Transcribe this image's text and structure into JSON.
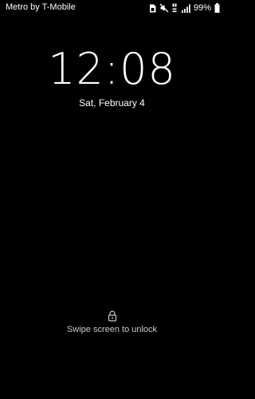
{
  "status_bar": {
    "carrier": "Metro by T-Mobile",
    "battery": "99%",
    "icons": [
      "sim-icon",
      "mute-icon",
      "volte-icon",
      "signal-icon",
      "battery-icon"
    ]
  },
  "lockscreen": {
    "time": "12:08",
    "date": "Sat, February 4",
    "unlock_hint": "Swipe screen to unlock",
    "lock_icon": "lock-icon"
  },
  "colors": {
    "background": "#000000",
    "text": "#ffffff",
    "hint_text": "#c8c8c8"
  }
}
